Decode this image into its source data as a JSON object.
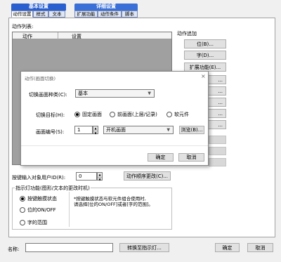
{
  "groups": {
    "basic": {
      "label": "基本设置",
      "tabs": [
        "动作设置",
        "样式",
        "文本"
      ]
    },
    "detail": {
      "label": "详细设置",
      "tabs": [
        "扩展功能",
        "动作条件",
        "脚本"
      ]
    }
  },
  "action_list": {
    "label": "动作列表:",
    "columns": [
      "动作",
      "设置"
    ]
  },
  "action_add": {
    "label": "动作追加",
    "buttons": [
      "位(B)...",
      "字(D)...",
      "扩展功能(E)..."
    ],
    "partial_buttons": [
      "...",
      "...",
      "...",
      "...",
      "..."
    ]
  },
  "dialog": {
    "title": "动作(画面切换)",
    "close": "×",
    "screen_type": {
      "label": "切换画面种类(C):",
      "value": "基本"
    },
    "target": {
      "label": "切换目标(H):",
      "options": [
        "固定画面",
        "前画面(上层/记录)",
        "软元件"
      ],
      "selected": 0
    },
    "screen_no": {
      "label": "画面编号(S):",
      "value": "1",
      "name_value": "开机画面",
      "browse": "浏览(B)..."
    },
    "ok": "确定",
    "cancel": "取消"
  },
  "input_user": {
    "label": "按键输入对象用户ID(R):",
    "value": "0"
  },
  "order_change": "动作顺序更改(C)...",
  "indicator": {
    "legend": "指示灯功能(图形/文本的更改时机)",
    "options": [
      "按键触摸状态",
      "位的ON/OFF",
      "字的范围"
    ],
    "selected": 0,
    "note_line1": "*按键触摸状态与软元件组合使用时,",
    "note_line2": "请选择[位的ON/OFF]或者[字的范围]。"
  },
  "footer": {
    "name_label": "名称:",
    "name_value": "",
    "convert": "转换至指示灯...",
    "ok": "确定",
    "cancel": "取消"
  }
}
